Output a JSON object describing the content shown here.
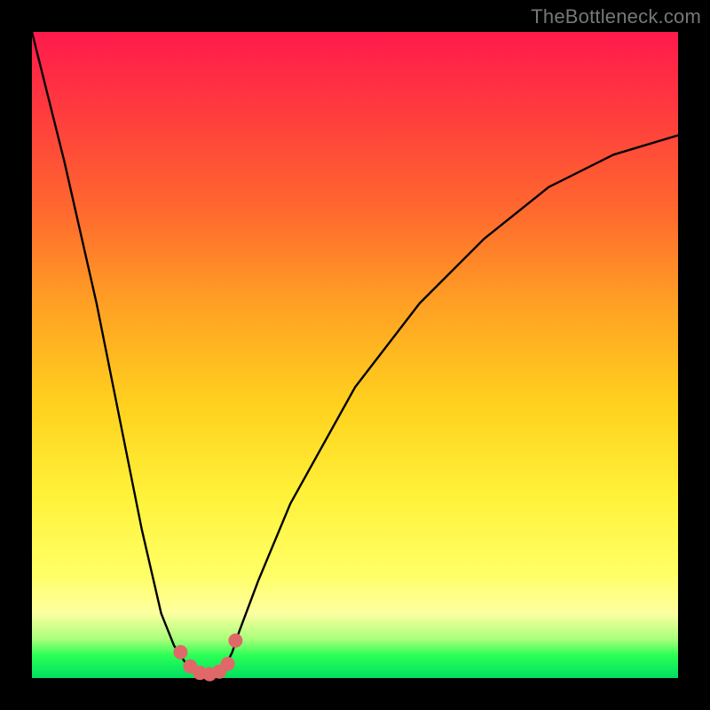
{
  "watermark": "TheBottleneck.com",
  "chart_data": {
    "type": "line",
    "title": "",
    "xlabel": "",
    "ylabel": "",
    "xlim": [
      0,
      100
    ],
    "ylim": [
      0,
      100
    ],
    "series": [
      {
        "name": "bottleneck-curve",
        "x": [
          0,
          5,
          10,
          15,
          17,
          20,
          22,
          24,
          25,
          26,
          27,
          28,
          29,
          30,
          31,
          32,
          35,
          40,
          50,
          60,
          70,
          80,
          90,
          100
        ],
        "values": [
          100,
          80,
          58,
          33,
          23,
          10,
          5,
          2,
          1,
          0.5,
          0.3,
          0.5,
          1,
          2,
          4,
          7,
          15,
          27,
          45,
          58,
          68,
          76,
          81,
          84
        ]
      }
    ],
    "markers": {
      "name": "highlight-dots",
      "x": [
        23.0,
        24.5,
        26.0,
        27.5,
        29.0,
        30.3,
        31.5
      ],
      "values": [
        4.0,
        1.8,
        0.8,
        0.6,
        1.0,
        2.2,
        5.8
      ]
    },
    "colors": {
      "curve": "#000000",
      "marker": "#e06868",
      "gradient_top": "#ff1a4c",
      "gradient_bottom": "#00e060",
      "background": "#000000"
    }
  }
}
